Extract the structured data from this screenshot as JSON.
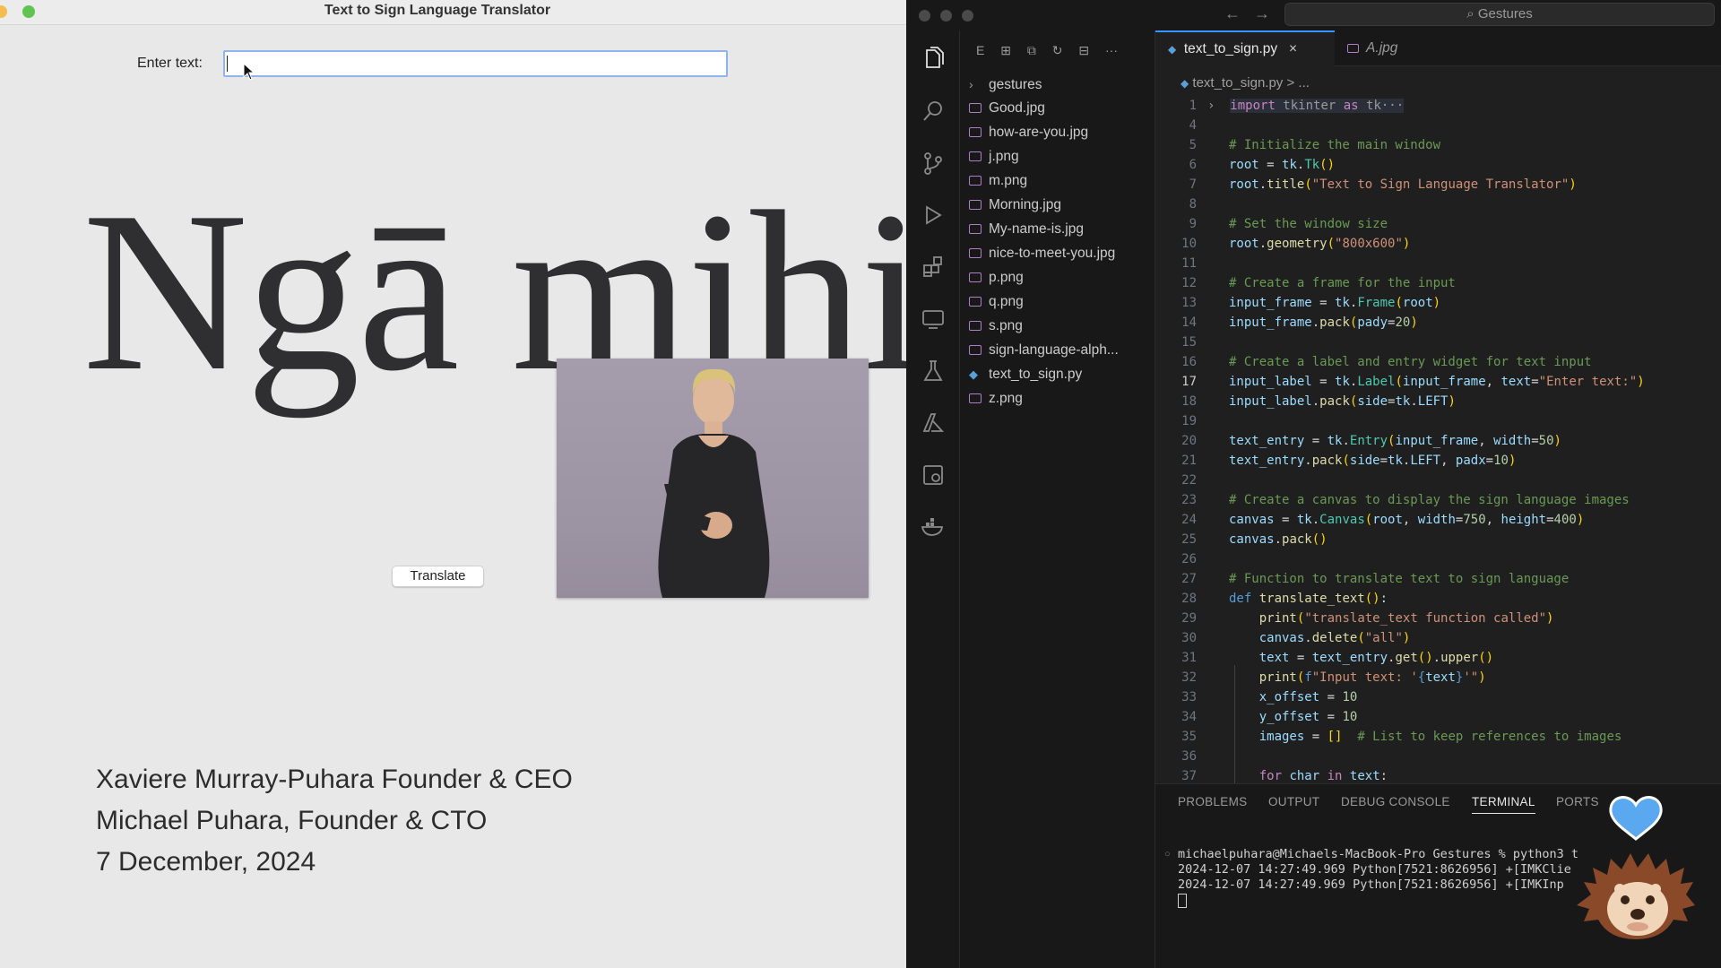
{
  "tk_window": {
    "title": "Text to Sign Language Translator",
    "entry_label": "Enter text:",
    "entry_value": "",
    "translate_button": "Translate"
  },
  "slide": {
    "greeting": "Ngā mihi",
    "credits": [
      "Xaviere Murray-Puhara Founder & CEO",
      "Michael Puhara, Founder & CTO",
      "7 December, 2024"
    ]
  },
  "vscode": {
    "search_label": "Gestures",
    "explorer_files": [
      "gestures",
      "Good.jpg",
      "how-are-you.jpg",
      "j.png",
      "m.png",
      "Morning.jpg",
      "My-name-is.jpg",
      "nice-to-meet-you.jpg",
      "p.png",
      "q.png",
      "s.png",
      "sign-language-alph...",
      "text_to_sign.py",
      "z.png"
    ],
    "tabs": [
      "text_to_sign.py",
      "A.jpg"
    ],
    "breadcrumb": "text_to_sign.py > ...",
    "line_numbers": [
      "1",
      "4",
      "5",
      "6",
      "7",
      "8",
      "9",
      "10",
      "11",
      "12",
      "13",
      "14",
      "15",
      "16",
      "17",
      "18",
      "19",
      "20",
      "21",
      "22",
      "23",
      "24",
      "25",
      "26",
      "27",
      "28",
      "29",
      "30",
      "31",
      "32",
      "33",
      "34",
      "35",
      "36",
      "37"
    ],
    "current_line": "17",
    "panel_tabs": [
      "PROBLEMS",
      "OUTPUT",
      "DEBUG CONSOLE",
      "TERMINAL",
      "PORTS"
    ],
    "terminal_lines": [
      "michaelpuhara@Michaels-MacBook-Pro Gestures % python3 t",
      "2024-12-07 14:27:49.969 Python[7521:8626956] +[IMKClie",
      "2024-12-07 14:27:49.969 Python[7521:8626956] +[IMKInp"
    ]
  },
  "icons": {
    "explorer": "files-icon",
    "search": "search-icon",
    "scm": "source-control-icon",
    "run": "run-debug-icon",
    "extensions": "extensions-icon",
    "remote": "remote-explorer-icon",
    "testing": "testing-icon",
    "azure": "azure-icon",
    "containers": "containers-icon",
    "docker": "docker-icon"
  },
  "colors": {
    "editor_bg": "#1f1f1f",
    "accent": "#3794ff",
    "heart": "#5aa9f0"
  }
}
